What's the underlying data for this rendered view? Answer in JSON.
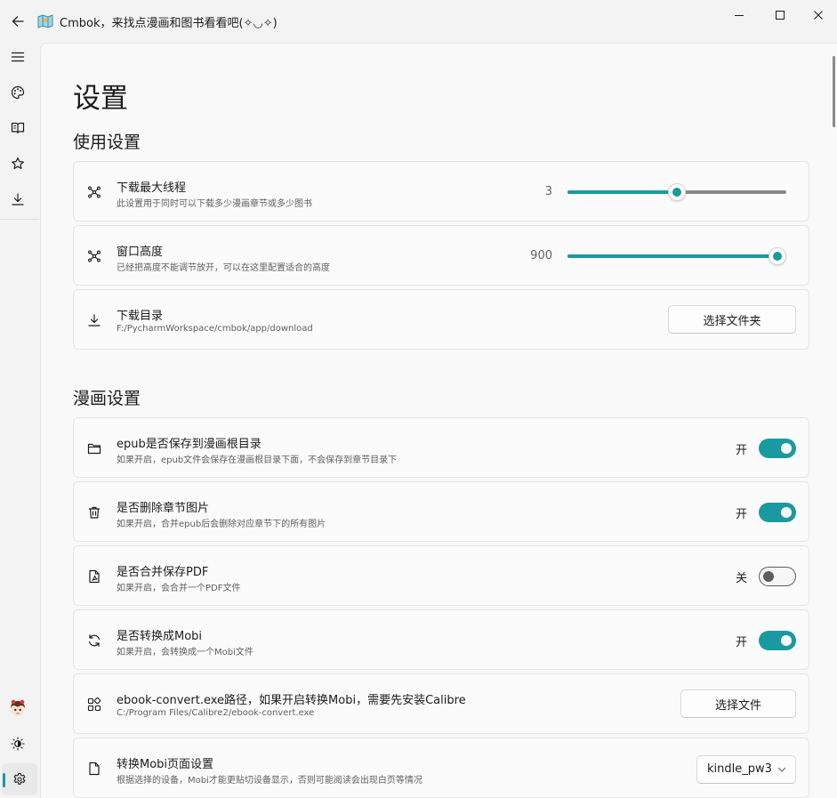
{
  "window": {
    "title": "Cmbok，来找点漫画和图书看看吧(✧◡✧)"
  },
  "page": {
    "title": "设置"
  },
  "sections": {
    "usage": "使用设置",
    "comic": "漫画设置"
  },
  "settings": {
    "max_threads": {
      "title": "下载最大线程",
      "desc": "此设置用于同时可以下载多少漫画章节或多少图书",
      "value": "3",
      "level": 0.5
    },
    "window_height": {
      "title": "窗口高度",
      "desc": "已经把高度不能调节放开，可以在这里配置适合的高度",
      "value": "900",
      "level": 1.0
    },
    "download_dir": {
      "title": "下载目录",
      "desc": "F:/PycharmWorkspace/cmbok/app/download",
      "button": "选择文件夹"
    },
    "epub_root": {
      "title": "epub是否保存到漫画根目录",
      "desc": "如果开启，epub文件会保存在漫画根目录下面，不会保存到章节目录下",
      "state": "开"
    },
    "delete_images": {
      "title": "是否删除章节图片",
      "desc": "如果开启，合并epub后会删除对应章节下的所有图片",
      "state": "开"
    },
    "merge_pdf": {
      "title": "是否合并保存PDF",
      "desc": "如果开启，会合并一个PDF文件",
      "state": "关"
    },
    "convert_mobi": {
      "title": "是否转换成Mobi",
      "desc": "如果开启，会转换成一个Mobi文件",
      "state": "开"
    },
    "ebook_convert": {
      "title": "ebook-convert.exe路径，如果开启转换Mobi，需要先安装Calibre",
      "desc": "C:/Program Files/Calibre2/ebook-convert.exe",
      "button": "选择文件"
    },
    "mobi_page": {
      "title": "转换Mobi页面设置",
      "desc": "根据选择的设备，Mobi才能更贴切设备显示，否则可能阅读会出现白页等情况",
      "selected": "kindle_pw3"
    }
  },
  "colors": {
    "accent": "#1a9aa0",
    "background": "#f3f3f3",
    "card": "#fbfbfb"
  },
  "icons": {
    "nav": [
      "menu-icon",
      "palette-icon",
      "book-icon",
      "star-icon",
      "download-icon"
    ],
    "nav_bottom": [
      "avatar",
      "theme-icon",
      "settings-icon"
    ]
  }
}
